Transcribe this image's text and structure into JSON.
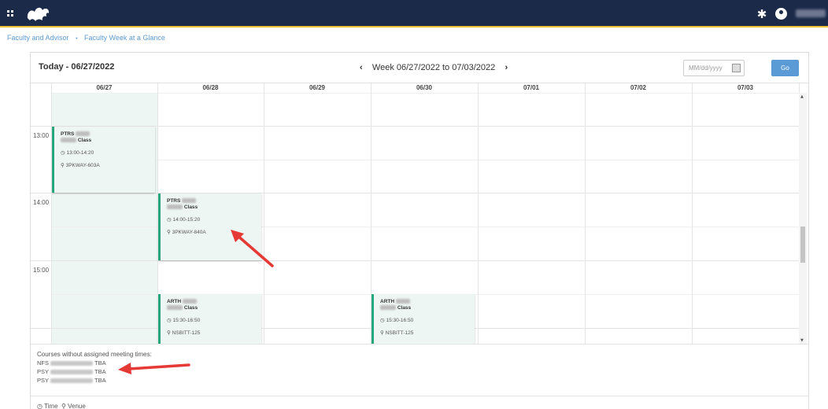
{
  "breadcrumb": {
    "parent": "Faculty and Advisor",
    "separator": "•",
    "current": "Faculty Week at a Glance"
  },
  "header": {
    "today_label": "Today - 06/27/2022",
    "week_label": "Week 06/27/2022 to 07/03/2022",
    "prev": "‹",
    "next": "›"
  },
  "date_picker": {
    "placeholder": "MM/dd/yyyy",
    "go_label": "Go"
  },
  "days": [
    "06/27",
    "06/28",
    "06/29",
    "06/30",
    "07/01",
    "07/02",
    "07/03"
  ],
  "times": [
    "13:00",
    "14:00",
    "15:00"
  ],
  "events": [
    {
      "subject": "PTRS",
      "type": "Class",
      "time": "13:00-14:20",
      "venue": "3PKWAY-603A"
    },
    {
      "subject": "PTRS",
      "type": "Class",
      "time": "14:00-15:20",
      "venue": "3PKWAY-840A"
    },
    {
      "subject": "ARTH",
      "type": "Class",
      "time": "15:30-16:50",
      "venue": "NSBITT-125"
    },
    {
      "subject": "ARTH",
      "type": "Class",
      "time": "15:30-16:50",
      "venue": "NSBITT-125"
    }
  ],
  "unassigned": {
    "title": "Courses without assigned meeting times:",
    "courses": [
      {
        "subject": "NFS",
        "meeting": "TBA"
      },
      {
        "subject": "PSY",
        "meeting": "TBA"
      },
      {
        "subject": "PSY",
        "meeting": "TBA"
      }
    ]
  },
  "legend": {
    "time": "Time",
    "venue": "Venue"
  },
  "icons": {
    "time": "clock-icon",
    "venue": "location-pin-icon"
  },
  "colors": {
    "topbar": "#1b2a49",
    "accent_bar": "#f1c233",
    "event_border": "#26a67c",
    "event_bg": "#eef6f3",
    "link": "#5b9bd5",
    "annotation_arrow": "#e53935"
  }
}
